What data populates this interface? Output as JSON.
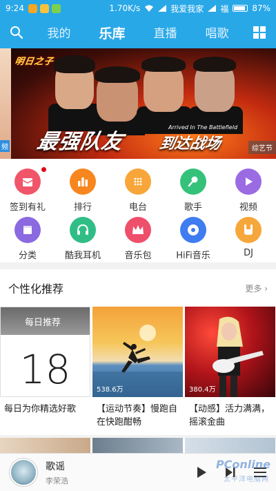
{
  "status_bar": {
    "time": "9:24",
    "net_speed": "1.70K/s",
    "carrier_1": "我爱我家",
    "carrier_2": "福",
    "battery": "87%"
  },
  "nav": {
    "tabs": [
      "我的",
      "乐库",
      "直播",
      "唱歌"
    ],
    "active_tab": "乐库"
  },
  "banner": {
    "logo_text": "明日之子",
    "headline": "最强队友",
    "subline": "到达战场",
    "english": "Arrived In The Battlefield",
    "tag": "综艺节",
    "left_tag": "频"
  },
  "quick_links": [
    {
      "label": "签到有礼",
      "icon": "gift-icon",
      "color": "#f0556a",
      "badge": true
    },
    {
      "label": "排行",
      "icon": "chart-bars-icon",
      "color": "#f7861f"
    },
    {
      "label": "电台",
      "icon": "radio-icon",
      "color": "#f8a63a"
    },
    {
      "label": "歌手",
      "icon": "microphone-icon",
      "color": "#34c27a"
    },
    {
      "label": "视频",
      "icon": "play-icon",
      "color": "#9a6be3"
    },
    {
      "label": "分类",
      "icon": "category-icon",
      "color": "#8b69e0"
    },
    {
      "label": "酷我耳机",
      "icon": "headphones-icon",
      "color": "#30be86"
    },
    {
      "label": "音乐包",
      "icon": "crown-icon",
      "color": "#ee4f6a"
    },
    {
      "label": "HiFi音乐",
      "icon": "disc-icon",
      "color": "#3e7cf0"
    },
    {
      "label": "DJ",
      "icon": "rock-hand-icon",
      "color": "#f6a73b"
    }
  ],
  "section": {
    "title": "个性化推荐",
    "more": "更多 ›"
  },
  "cards": [
    {
      "caption": "每日为你精选好歌",
      "top_label": "每日推荐",
      "day": "18"
    },
    {
      "caption": "【运动节奏】慢跑自在快跑酣畅",
      "plays": "538.6万"
    },
    {
      "caption": "【动感】活力满满，摇滚金曲",
      "plays": "380.4万"
    }
  ],
  "player": {
    "song": "歌谣",
    "artist": "李荣浩"
  },
  "watermark": {
    "brand": "PConline",
    "sub": "太平洋电脑网"
  }
}
